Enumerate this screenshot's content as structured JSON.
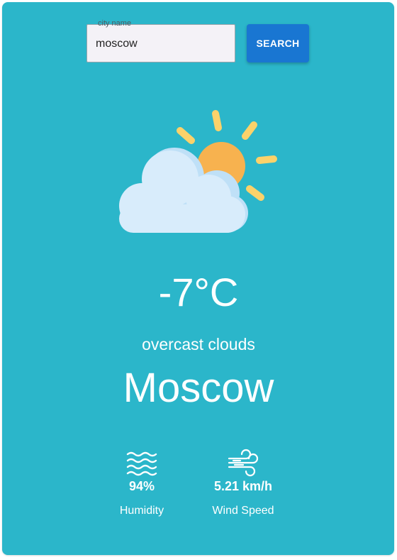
{
  "search": {
    "label": "city name",
    "value": "moscow",
    "button_label": "SEARCH"
  },
  "weather": {
    "icon": "partly-cloudy-icon",
    "temperature": "-7°C",
    "description": "overcast clouds",
    "city": "Moscow"
  },
  "stats": {
    "humidity": {
      "icon": "waves-icon",
      "value": "94%",
      "label": "Humidity"
    },
    "wind": {
      "icon": "wind-icon",
      "value": "5.21 km/h",
      "label": "Wind Speed"
    }
  },
  "colors": {
    "background": "#2bb6ca",
    "button": "#1976d2",
    "sun": "#f7b24f",
    "sun_rays": "#fbd26a",
    "cloud": "#d8ecfb"
  }
}
